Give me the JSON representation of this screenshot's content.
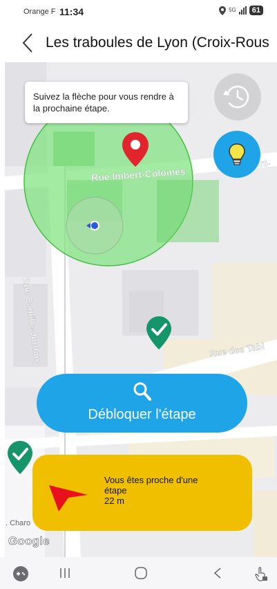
{
  "status_bar": {
    "carrier": "Orange F",
    "time": "11:34",
    "network": "5G",
    "battery": "61"
  },
  "header": {
    "title": "Les traboules de Lyon (Croix-Rous"
  },
  "map": {
    "tooltip": "Suivez la flèche pour vous rendre à la prochaine étape.",
    "streets": {
      "imbert_colomes": "Rue Imbert-Colomès",
      "imbert_colomes_right": "Rue Imbert-",
      "camille_jordan": "Rue Camille-Jordan",
      "des_tables": "Rue des Tabl",
      "charo": "Charo"
    },
    "attribution": "Google"
  },
  "unlock_button": {
    "label": "Débloquer l'étape"
  },
  "proximity_card": {
    "message_line1": "Vous êtes proche d'une",
    "message_line2": "étape",
    "distance": "22 m"
  },
  "colors": {
    "accent_blue": "#1fa4e8",
    "proximity_yellow": "#f0c000",
    "zone_green": "#7fe27f",
    "marker_red": "#e0262c",
    "check_green": "#16956a"
  },
  "icons": {
    "back": "chevron-left-icon",
    "history": "history-icon",
    "hint": "lightbulb-icon",
    "search": "search-icon",
    "direction": "direction-arrow-icon"
  }
}
